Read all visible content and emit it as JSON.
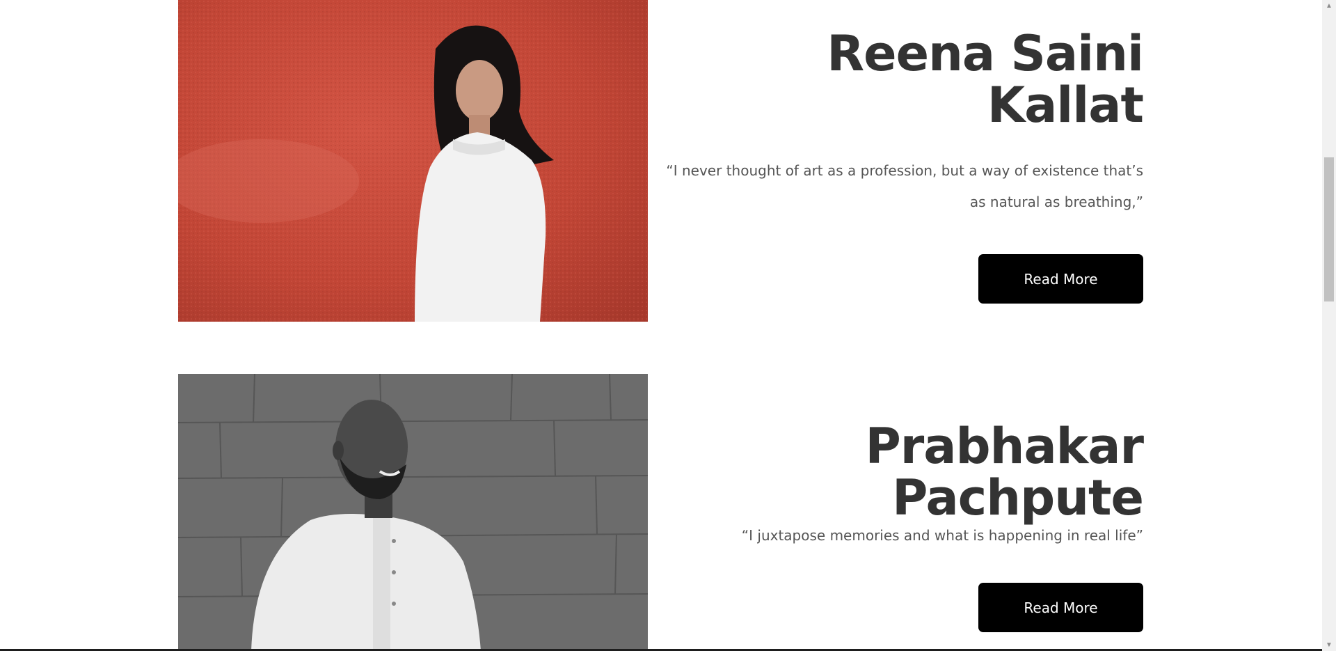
{
  "artists": [
    {
      "name": "Reena Saini Kallat",
      "quote": "“I never thought of art as a profession, but a way of existence that’s as natural as breathing,”",
      "button_label": "Read More",
      "photo_bg_color": "#c8483a"
    },
    {
      "name": "Prabhakar Pachpute",
      "quote": "“I juxtapose memories and what is happening in real life”",
      "button_label": "Read More",
      "photo_bg_color": "#6e6e6e"
    }
  ],
  "scrollbar": {
    "up_icon": "triangle-up",
    "down_icon": "triangle-down"
  }
}
